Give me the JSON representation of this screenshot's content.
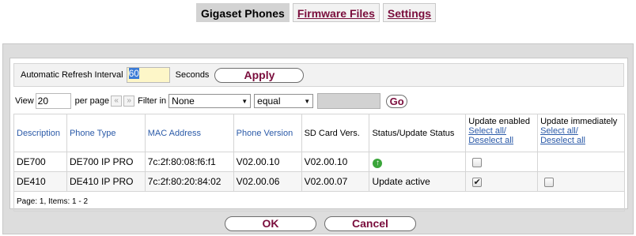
{
  "tabs": [
    {
      "label": "Gigaset Phones"
    },
    {
      "label": "Firmware Files"
    },
    {
      "label": "Settings"
    }
  ],
  "refresh": {
    "label": "Automatic Refresh Interval",
    "value": "60",
    "unit": "Seconds",
    "apply_label": "Apply"
  },
  "filters": {
    "view_label": "View",
    "per_page_value": "20",
    "per_page_label": "per page",
    "prev_icon": "«",
    "next_icon": "»",
    "filter_in_label": "Filter in",
    "field_selected": "None",
    "operator_selected": "equal",
    "go_label": "Go"
  },
  "table": {
    "headers": {
      "description": "Description",
      "phone_type": "Phone Type",
      "mac_address": "MAC Address",
      "phone_version": "Phone Version",
      "sd_card": "SD Card Vers.",
      "status": "Status/Update Status",
      "update_enabled": "Update enabled",
      "update_immediately": "Update immediately",
      "select_all": "Select all/",
      "deselect_all": "Deselect all"
    },
    "rows": [
      {
        "description": "DE700",
        "phone_type": "DE700 IP PRO",
        "mac": "7c:2f:80:08:f6:f1",
        "phone_version": "V02.00.10",
        "sd_card": "V02.00.10",
        "status": "",
        "status_icon": "green-up-arrow-icon",
        "update_enabled": false,
        "update_immediately": null
      },
      {
        "description": "DE410",
        "phone_type": "DE410 IP PRO",
        "mac": "7c:2f:80:20:84:02",
        "phone_version": "V02.00.06",
        "sd_card": "V02.00.07",
        "status": "Update active",
        "update_enabled": true,
        "update_immediately": false
      }
    ],
    "footer": "Page:  1, Items:  1 - 2"
  },
  "actions": {
    "ok_label": "OK",
    "cancel_label": "Cancel"
  },
  "colors": {
    "accent": "#7a0d3c",
    "link": "#2b5aa8",
    "panel": "#dddddd"
  }
}
